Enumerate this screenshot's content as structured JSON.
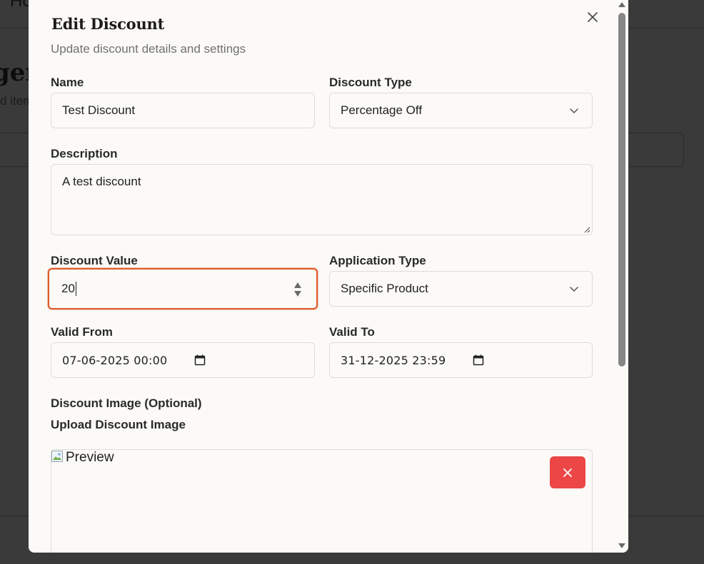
{
  "background": {
    "topbar_text": "Ho",
    "heading": "ger",
    "subheading": "d item"
  },
  "modal": {
    "title": "Edit Discount",
    "subtitle": "Update discount details and settings",
    "close_icon": "close-icon",
    "fields": {
      "name": {
        "label": "Name",
        "value": "Test Discount"
      },
      "discount_type": {
        "label": "Discount Type",
        "value": "Percentage Off"
      },
      "description": {
        "label": "Description",
        "value": "A test discount"
      },
      "discount_value": {
        "label": "Discount Value",
        "value": "20"
      },
      "application_type": {
        "label": "Application Type",
        "value": "Specific Product"
      },
      "valid_from": {
        "label": "Valid From",
        "value": "07-06-2025 00:00"
      },
      "valid_to": {
        "label": "Valid To",
        "value": "31-12-2025 23:59"
      }
    },
    "image_section": {
      "label": "Discount Image (Optional)",
      "upload_label": "Upload Discount Image",
      "preview_alt": "Preview",
      "remove_icon": "close-icon"
    }
  },
  "colors": {
    "focus_ring": "#e0592b",
    "remove_button": "#ec4646",
    "modal_bg": "#fbfaf7"
  }
}
